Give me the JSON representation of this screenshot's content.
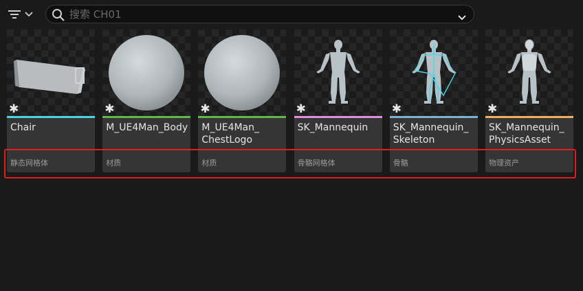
{
  "search": {
    "placeholder": "搜索 CH01",
    "icon": "search-icon"
  },
  "toolbar": {
    "filter_icon": "filter-icon",
    "dropdown_icon": "chevron-down-icon"
  },
  "colors": {
    "static_mesh": "#4ad6e0",
    "material": "#5fb84a",
    "skeletal_mesh": "#e08ee0",
    "skeleton": "#7ab2d8",
    "physics_asset": "#f0b060",
    "highlight": "#e01e1e"
  },
  "assets": [
    {
      "name": "Chair",
      "type": "静态网格体",
      "color": "#4ad6e0",
      "thumb": "chair"
    },
    {
      "name": "M_UE4Man_Body",
      "type": "材质",
      "color": "#5fb84a",
      "thumb": "sphere"
    },
    {
      "name": "M_UE4Man_\nChestLogo",
      "type": "材质",
      "color": "#5fb84a",
      "thumb": "sphere"
    },
    {
      "name": "SK_Mannequin",
      "type": "骨骼网格体",
      "color": "#e08ee0",
      "thumb": "mannequin"
    },
    {
      "name": "SK_Mannequin_\nSkeleton",
      "type": "骨骼",
      "color": "#7ab2d8",
      "thumb": "skeleton"
    },
    {
      "name": "SK_Mannequin_\nPhysicsAsset",
      "type": "物理资产",
      "color": "#f0b060",
      "thumb": "physics"
    }
  ]
}
